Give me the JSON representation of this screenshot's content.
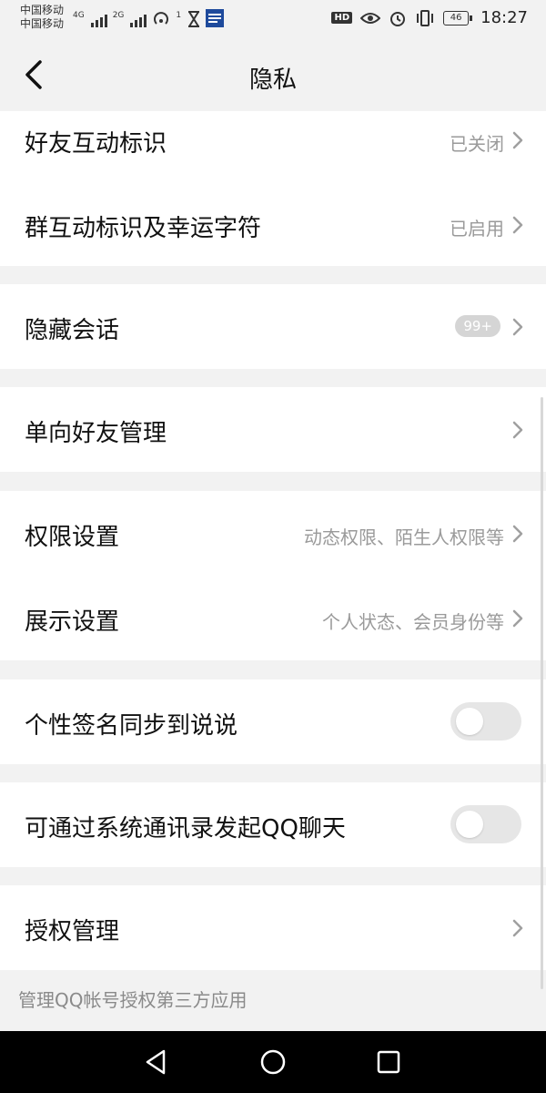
{
  "status_bar": {
    "carrier_1": "中国移动",
    "carrier_2": "中国移动",
    "net_1": "4G",
    "net_2": "2G",
    "hotspot_count": "1",
    "hd": "HD",
    "battery": "46",
    "time": "18:27"
  },
  "header": {
    "title": "隐私"
  },
  "rows": [
    {
      "label": "好友互动标识",
      "value": "已关闭"
    },
    {
      "label": "群互动标识及幸运字符",
      "value": "已启用"
    },
    {
      "label": "隐藏会话",
      "badge": "99+"
    },
    {
      "label": "单向好友管理"
    },
    {
      "label": "权限设置",
      "value": "动态权限、陌生人权限等"
    },
    {
      "label": "展示设置",
      "value": "个人状态、会员身份等"
    },
    {
      "label": "个性签名同步到说说",
      "toggle": false
    },
    {
      "label": "可通过系统通讯录发起QQ聊天",
      "toggle": false
    },
    {
      "label": "授权管理"
    }
  ],
  "footer_note": "管理QQ帐号授权第三方应用",
  "colors": {
    "background": "#f2f2f2",
    "row_background": "#ffffff",
    "secondary_text": "#9a9a9a",
    "toggle_off": "#e6e6e6",
    "system_nav": "#000000"
  },
  "icons": {
    "back": "chevron-left-icon",
    "row_arrow": "chevron-right-icon",
    "sys_back": "triangle-back-icon",
    "sys_home": "circle-home-icon",
    "sys_recent": "square-recent-icon"
  }
}
